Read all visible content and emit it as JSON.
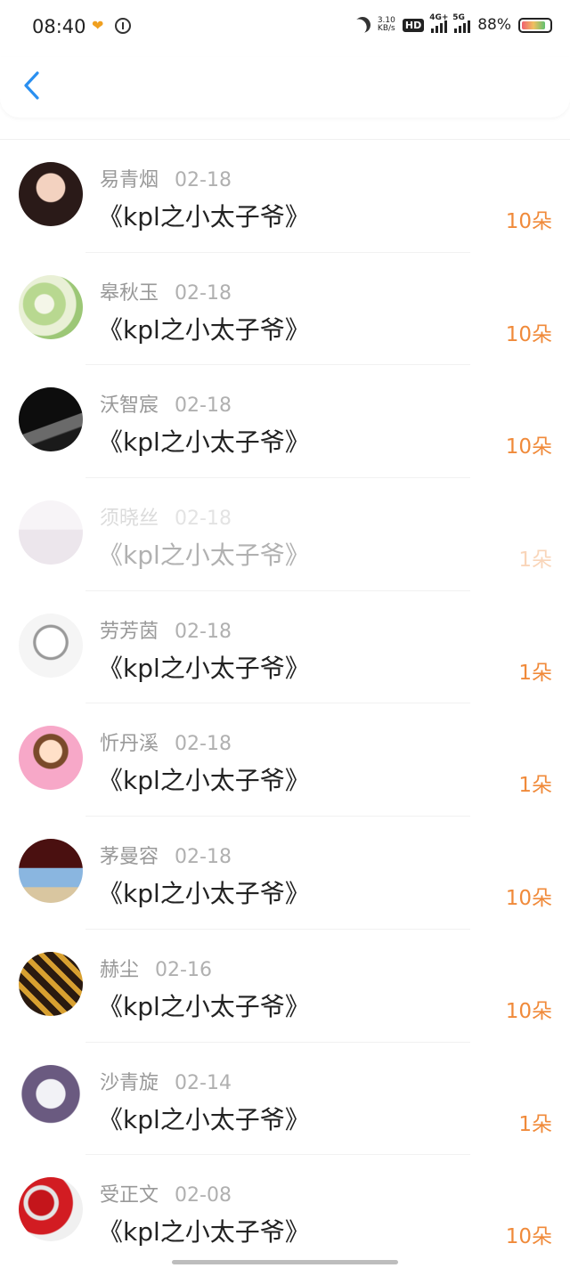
{
  "status_bar": {
    "time": "08:40",
    "net_speed_value": "3.10",
    "net_speed_unit": "KB/s",
    "hd_label": "HD",
    "signal1_label": "4G+",
    "signal2_label": "5G",
    "battery": "88%"
  },
  "colors": {
    "amount": "#f08a3a",
    "back": "#2a8ff0"
  },
  "rows": [
    {
      "name": "易青烟",
      "date": "02-18",
      "title": "《kpl之小太子爷》",
      "amount": "10朵",
      "avatar_icon": "avatar-portrait-woman",
      "dim": false
    },
    {
      "name": "皋秋玉",
      "date": "02-18",
      "title": "《kpl之小太子爷》",
      "amount": "10朵",
      "avatar_icon": "avatar-flowers",
      "dim": false
    },
    {
      "name": "沃智宸",
      "date": "02-18",
      "title": "《kpl之小太子爷》",
      "amount": "10朵",
      "avatar_icon": "avatar-dark-portrait",
      "dim": false
    },
    {
      "name": "须晓丝",
      "date": "02-18",
      "title": "《kpl之小太子爷》",
      "amount": "1朵",
      "avatar_icon": "avatar-room",
      "dim": true
    },
    {
      "name": "劳芳茵",
      "date": "02-18",
      "title": "《kpl之小太子爷》",
      "amount": "1朵",
      "avatar_icon": "avatar-anime-boy",
      "dim": false
    },
    {
      "name": "忻丹溪",
      "date": "02-18",
      "title": "《kpl之小太子爷》",
      "amount": "1朵",
      "avatar_icon": "avatar-cartoon-girl",
      "dim": false
    },
    {
      "name": "茅曼容",
      "date": "02-18",
      "title": "《kpl之小太子爷》",
      "amount": "10朵",
      "avatar_icon": "avatar-heart-sky",
      "dim": false
    },
    {
      "name": "赫尘",
      "date": "02-16",
      "title": "《kpl之小太子爷》",
      "amount": "10朵",
      "avatar_icon": "avatar-bee-scarf",
      "dim": false
    },
    {
      "name": "沙青旋",
      "date": "02-14",
      "title": "《kpl之小太子爷》",
      "amount": "1朵",
      "avatar_icon": "avatar-anime-white-hair",
      "dim": false
    },
    {
      "name": "受正文",
      "date": "02-08",
      "title": "《kpl之小太子爷》",
      "amount": "10朵",
      "avatar_icon": "avatar-red-roses",
      "dim": false
    }
  ]
}
